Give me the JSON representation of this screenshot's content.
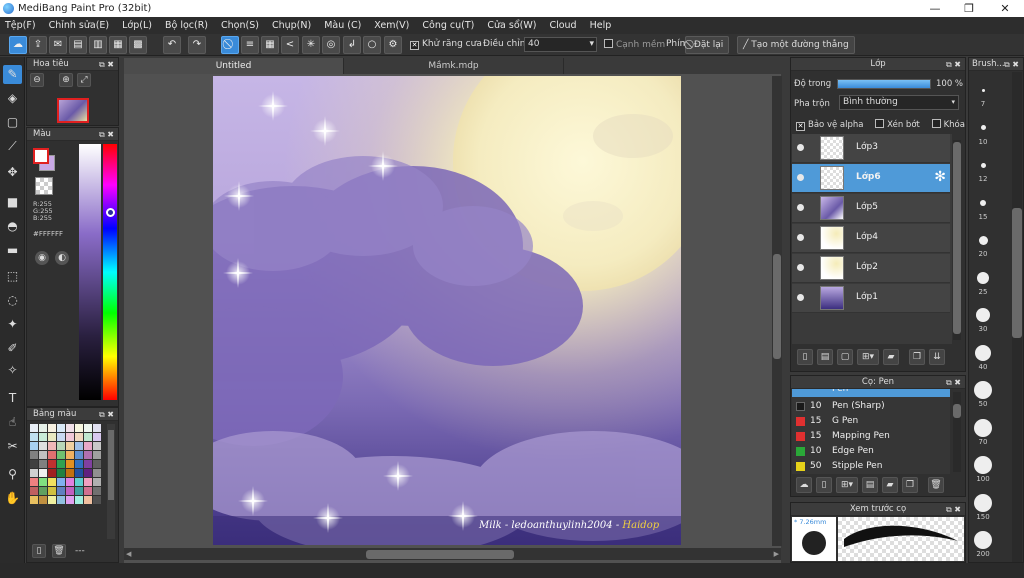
{
  "window": {
    "title": "MediBang Paint Pro (32bit)",
    "minimize": "—",
    "maximize": "❐",
    "close": "✕"
  },
  "menu": [
    "Tệp(F)",
    "Chỉnh sửa(E)",
    "Lớp(L)",
    "Bộ lọc(R)",
    "Chọn(S)",
    "Chụp(N)",
    "Màu (C)",
    "Xem(V)",
    "Công cụ(T)",
    "Cửa sổ(W)",
    "Cloud",
    "Help"
  ],
  "toolbar": {
    "antialias_label": "Khử răng cưa",
    "antialias_checked": "✕",
    "correction_label": "Điều chỉnh",
    "correction_value": "40",
    "correction_arrow": "▾",
    "edge_label": "Cạnh mềm",
    "key_label": "Phím",
    "reset_label": "Đặt lại",
    "straight_line_label": "Tạo một đường thẳng"
  },
  "navigator": {
    "title": "Hoa tiêu"
  },
  "color": {
    "title": "Màu",
    "r": "R:255",
    "g": "G:255",
    "b": "B:255",
    "hex": "#FFFFFF",
    "primary": "#ffffff",
    "secondary": "#c9a9e6"
  },
  "palette": {
    "title": "Bảng màu",
    "more": "---"
  },
  "tabs": [
    "Untitled",
    "Mầmk.mdp"
  ],
  "canvas": {
    "signature": "Milk - ledoanthuylinh2004 -",
    "signature_tag": "Haidop"
  },
  "layers": {
    "title": "Lớp",
    "opacity_label": "Độ trong",
    "opacity_value": "100 %",
    "opacity_level": 1.0,
    "blend_label": "Pha trộn",
    "blend_value": "Bình thường",
    "protect_alpha": "Bảo vệ alpha",
    "clipping": "Xén bớt",
    "lock": "Khóa",
    "items": [
      {
        "name": "Lớp3",
        "selected": false
      },
      {
        "name": "Lớp6",
        "selected": true
      },
      {
        "name": "Lớp5",
        "selected": false
      },
      {
        "name": "Lớp4",
        "selected": false
      },
      {
        "name": "Lớp2",
        "selected": false
      },
      {
        "name": "Lớp1",
        "selected": false
      }
    ]
  },
  "brush_list": {
    "title": "Cọ: Pen",
    "items": [
      {
        "size": "10",
        "name": "Pen (Sharp)",
        "color": "#1a1a1a"
      },
      {
        "size": "15",
        "name": "G Pen",
        "color": "#e03030"
      },
      {
        "size": "15",
        "name": "Mapping Pen",
        "color": "#e03030"
      },
      {
        "size": "10",
        "name": "Edge Pen",
        "color": "#2aa838"
      },
      {
        "size": "50",
        "name": "Stipple Pen",
        "color": "#e6d21a"
      }
    ],
    "partial_top": "Pen"
  },
  "brush_preview": {
    "title": "Xem trước cọ",
    "size": "* 7.26mm"
  },
  "brush_sizes": {
    "title": "Brush...",
    "sizes": [
      "7",
      "10",
      "12",
      "15",
      "20",
      "25",
      "30",
      "40",
      "50",
      "70",
      "100",
      "150",
      "200"
    ]
  }
}
